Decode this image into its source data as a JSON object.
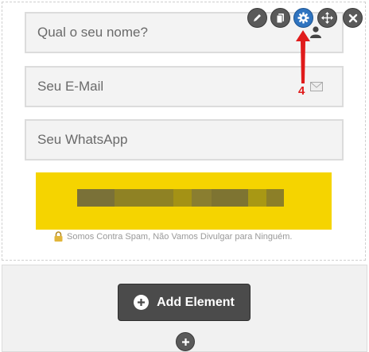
{
  "form": {
    "name_placeholder": "Qual o seu nome?",
    "email_placeholder": "Seu E-Mail",
    "whatsapp_placeholder": "Seu WhatsApp",
    "spam_note": "Somos Contra Spam, Não Vamos Divulgar para Ninguém."
  },
  "toolbar": {
    "buttons": [
      "pencil-icon",
      "copy-icon",
      "gear-icon",
      "move-icon",
      "close-icon"
    ],
    "active": "gear-icon"
  },
  "annotation": {
    "number": "4",
    "color": "#e01b1b"
  },
  "colors": {
    "submit_bg": "#f5d400",
    "active_tool": "#2f74c0",
    "tool_bg": "#5a5a5a",
    "add_button_bg": "#4b4b4b"
  },
  "add_element": {
    "label": "Add Element"
  }
}
